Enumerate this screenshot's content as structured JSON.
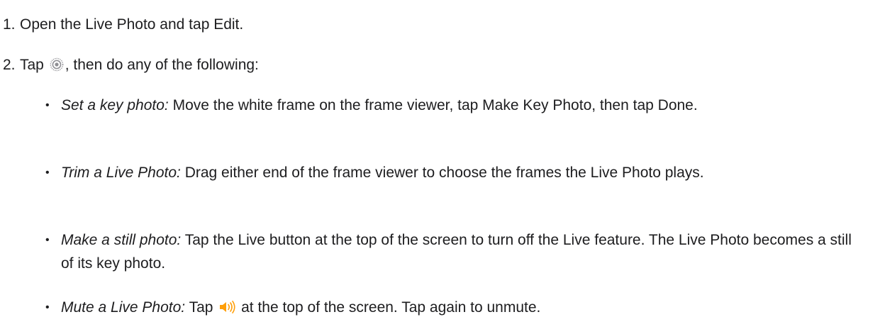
{
  "steps": [
    {
      "number": "1.",
      "text": "Open the Live Photo and tap Edit."
    },
    {
      "number": "2.",
      "prefix": "Tap",
      "icon": "live-photo-icon",
      "suffix": ", then do any of the following:"
    }
  ],
  "bullets": [
    {
      "term": "Set a key photo:",
      "text": "Move the white frame on the frame viewer, tap Make Key Photo, then tap Done."
    },
    {
      "term": "Trim a Live Photo:",
      "text": "Drag either end of the frame viewer to choose the frames the Live Photo plays."
    },
    {
      "term": "Make a still photo:",
      "text": "Tap the Live button at the top of the screen to turn off the Live feature. The Live Photo becomes a still of its key photo."
    },
    {
      "term": "Mute a Live Photo:",
      "prefix": "Tap",
      "icon": "speaker-icon",
      "suffix": "at the top of the screen. Tap again to unmute."
    }
  ],
  "bullet_marker": "•",
  "colors": {
    "text": "#1d1d1f",
    "live_icon": "#8e8e93",
    "speaker_icon": "#ff9f0a"
  }
}
